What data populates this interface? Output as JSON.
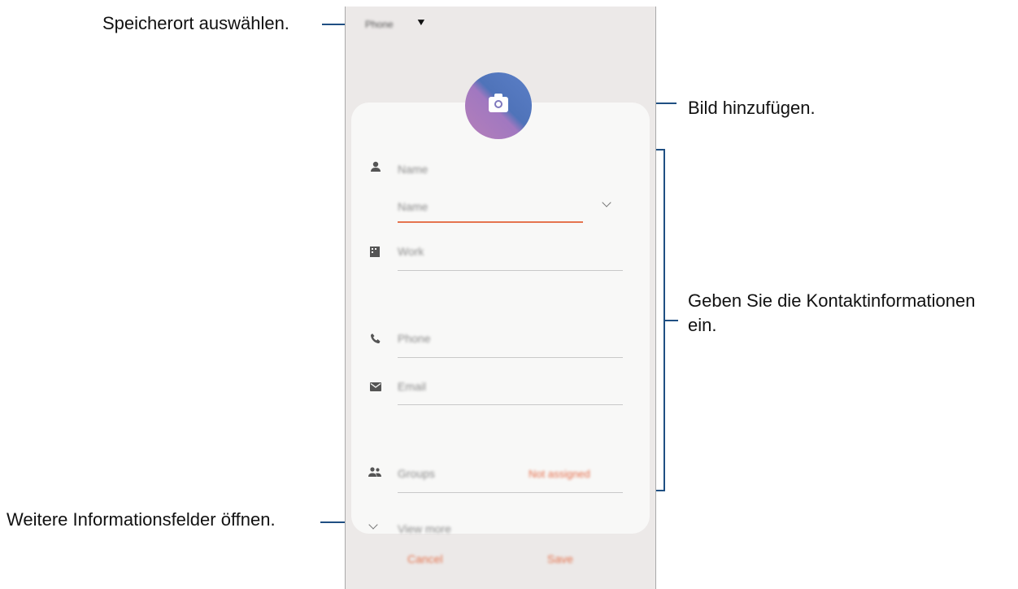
{
  "callouts": {
    "storage": "Speicherort auswählen.",
    "photo": "Bild hinzufügen.",
    "contact_info_line1": "Geben Sie die Kontaktinformationen",
    "contact_info_line2": "ein.",
    "more_fields": "Weitere Informationsfelder öffnen."
  },
  "phone": {
    "storage_selector": "Phone",
    "fields": {
      "name": "Name",
      "name_sub": "Name",
      "work": "Work",
      "phone": "Phone",
      "email": "Email",
      "groups": "Groups",
      "groups_value": "Not assigned",
      "view_more": "View more"
    },
    "buttons": {
      "cancel": "Cancel",
      "save": "Save"
    }
  },
  "colors": {
    "accent": "#e5744f",
    "leader": "#1f4f82"
  },
  "icons": [
    "camera-icon",
    "person-icon",
    "building-icon",
    "phone-icon",
    "email-icon",
    "groups-icon",
    "chevron-down-icon",
    "dropdown-arrow-icon"
  ]
}
